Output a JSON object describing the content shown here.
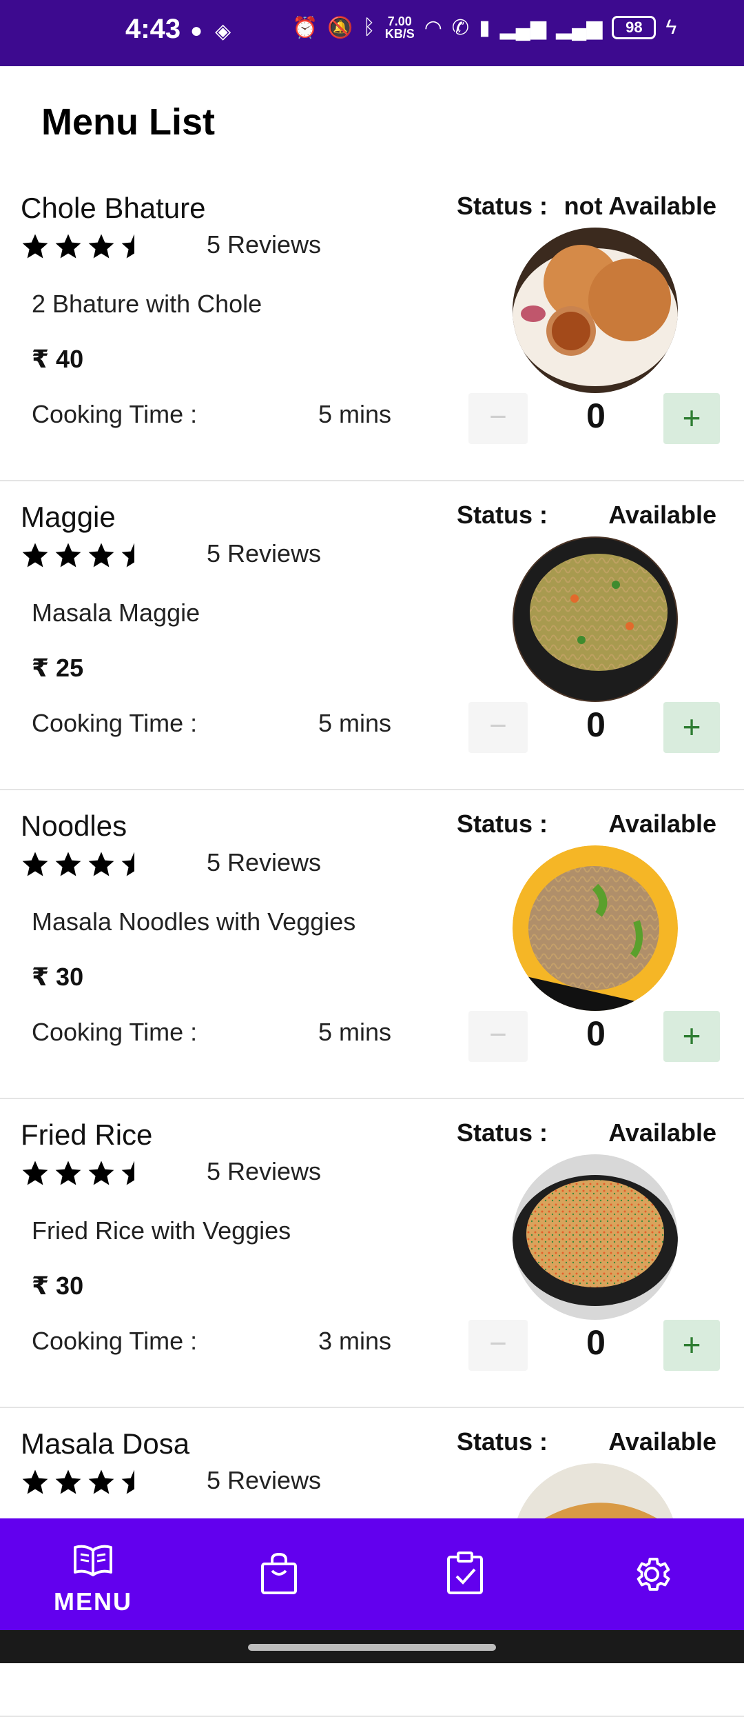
{
  "status_bar": {
    "time": "4:43",
    "net_speed_value": "7.00",
    "net_speed_unit": "KB/S",
    "battery": "98"
  },
  "header": {
    "title": "Menu List"
  },
  "menu_items": [
    {
      "name": "Chole Bhature",
      "rating": 3.5,
      "reviews": "5 Reviews",
      "description": "2 Bhature with Chole",
      "price": "₹ 40",
      "cooking_label": "Cooking Time :",
      "cooking_time": "5 mins",
      "status_label": "Status :",
      "status": "not Available",
      "quantity": "0",
      "image": "chole-bhature"
    },
    {
      "name": "Maggie",
      "rating": 3.5,
      "reviews": "5 Reviews",
      "description": "Masala Maggie",
      "price": "₹ 25",
      "cooking_label": "Cooking Time :",
      "cooking_time": "5 mins",
      "status_label": "Status :",
      "status": "Available",
      "quantity": "0",
      "image": "maggie"
    },
    {
      "name": "Noodles",
      "rating": 3.5,
      "reviews": "5 Reviews",
      "description": "Masala Noodles with Veggies",
      "price": "₹ 30",
      "cooking_label": "Cooking Time :",
      "cooking_time": "5 mins",
      "status_label": "Status :",
      "status": "Available",
      "quantity": "0",
      "image": "noodles"
    },
    {
      "name": "Fried Rice",
      "rating": 3.5,
      "reviews": "5 Reviews",
      "description": "Fried Rice with Veggies",
      "price": "₹ 30",
      "cooking_label": "Cooking Time :",
      "cooking_time": "3 mins",
      "status_label": "Status :",
      "status": "Available",
      "quantity": "0",
      "image": "fried-rice"
    },
    {
      "name": "Masala Dosa",
      "rating": 3.5,
      "reviews": "5 Reviews",
      "status_label": "Status :",
      "status": "Available",
      "image": "masala-dosa"
    }
  ],
  "bottom_nav": {
    "items": [
      {
        "label": "MENU",
        "icon": "book-open-icon",
        "active": true
      },
      {
        "label": "",
        "icon": "shopping-bag-icon",
        "active": false
      },
      {
        "label": "",
        "icon": "clipboard-check-icon",
        "active": false
      },
      {
        "label": "",
        "icon": "gear-icon",
        "active": false
      }
    ]
  },
  "colors": {
    "status_bar": "#3d0a8f",
    "bottom_nav": "#6200ee",
    "plus_button_bg": "#d9ecdd",
    "plus_button_fg": "#2e7d32"
  }
}
